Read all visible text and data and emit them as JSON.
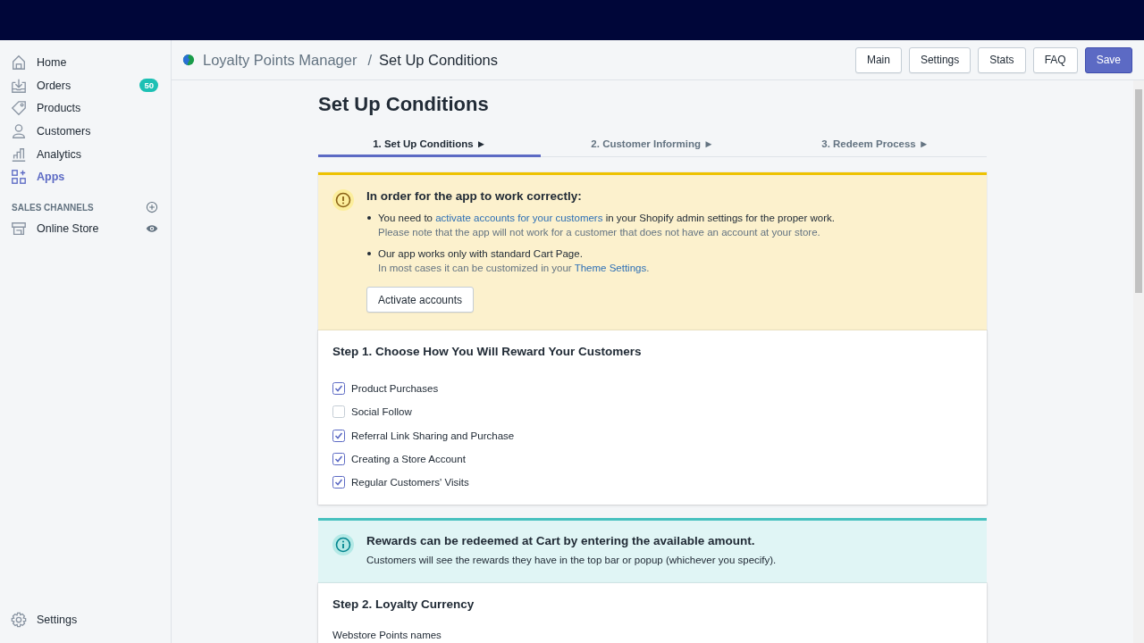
{
  "sidebar": {
    "items": [
      {
        "label": "Home",
        "selected": false
      },
      {
        "label": "Orders",
        "selected": false,
        "badge": "50"
      },
      {
        "label": "Products",
        "selected": false
      },
      {
        "label": "Customers",
        "selected": false
      },
      {
        "label": "Analytics",
        "selected": false
      },
      {
        "label": "Apps",
        "selected": true
      }
    ],
    "section_title": "SALES CHANNELS",
    "channels": [
      {
        "label": "Online Store"
      }
    ],
    "footer_item": {
      "label": "Settings"
    }
  },
  "header": {
    "app_name": "Loyalty Points Manager",
    "separator": "/",
    "page": "Set Up Conditions",
    "buttons": [
      {
        "label": "Main",
        "primary": false
      },
      {
        "label": "Settings",
        "primary": false
      },
      {
        "label": "Stats",
        "primary": false
      },
      {
        "label": "FAQ",
        "primary": false
      },
      {
        "label": "Save",
        "primary": true
      }
    ]
  },
  "title": "Set Up Conditions",
  "tabs": [
    {
      "label": "1. Set Up Conditions ►",
      "selected": true
    },
    {
      "label": "2. Customer Informing ►",
      "selected": false
    },
    {
      "label": "3. Redeem Process ►",
      "selected": false
    }
  ],
  "warning": {
    "title": "In order for the app to work correctly:",
    "items": [
      {
        "before": "You need to ",
        "link": "activate accounts for your customers",
        "after": " in your Shopify admin settings for the proper work.",
        "note_before": "Please note that the app will not work for a customer that does not have an account at your store."
      },
      {
        "before": "Our app works only with standard Cart Page.",
        "note_before": "In most cases it can be customized in your ",
        "note_link": "Theme Settings",
        "note_after": "."
      }
    ],
    "button": "Activate accounts"
  },
  "step1": {
    "title": "Step 1. Choose How You Will Reward Your Customers",
    "options": [
      {
        "label": "Product Purchases",
        "checked": true
      },
      {
        "label": "Social Follow",
        "checked": false
      },
      {
        "label": "Referral Link Sharing and Purchase",
        "checked": true
      },
      {
        "label": "Creating a Store Account",
        "checked": true
      },
      {
        "label": "Regular Customers' Visits",
        "checked": true
      }
    ]
  },
  "info": {
    "title": "Rewards can be redeemed at Cart by entering the available amount.",
    "text": "Customers will see the rewards they have in the top bar or popup (whichever you specify)."
  },
  "step2": {
    "title": "Step 2. Loyalty Currency",
    "field_label": "Webstore Points names"
  }
}
